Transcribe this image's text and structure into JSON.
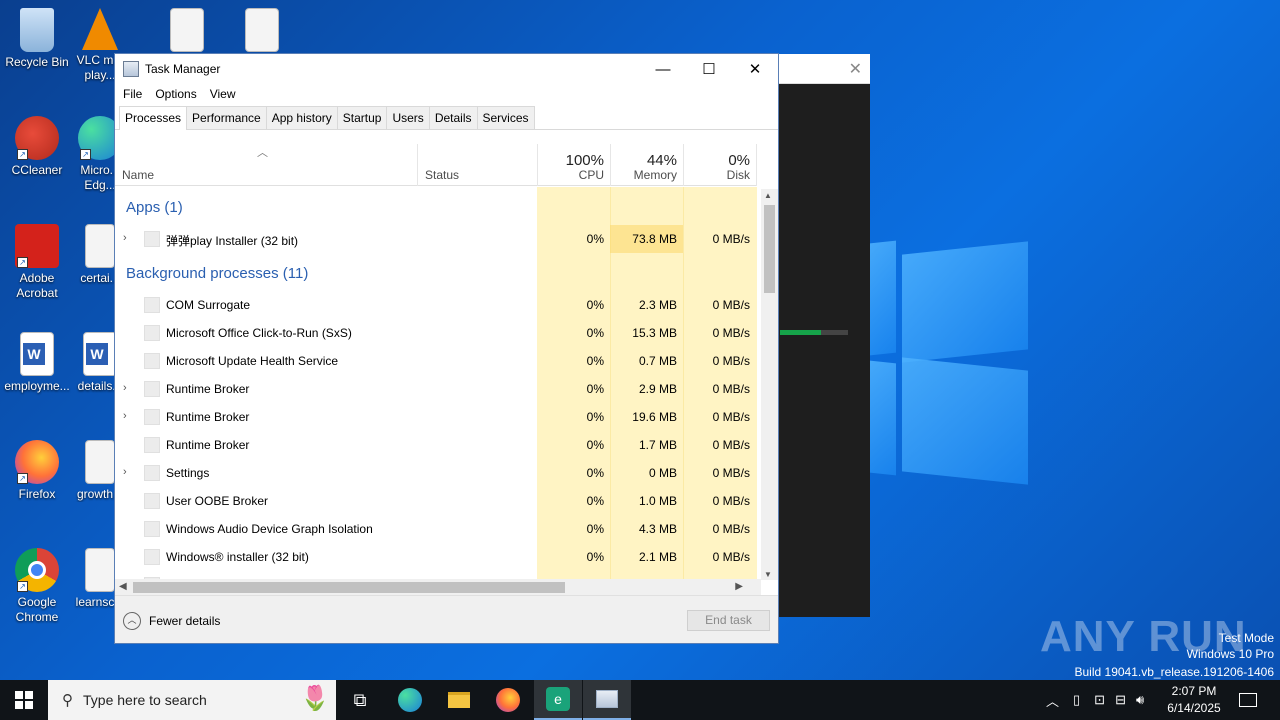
{
  "desktop": {
    "icons": [
      {
        "label": "Recycle Bin"
      },
      {
        "label": "VLC m... play..."
      },
      {
        "label": "CCleaner"
      },
      {
        "label": "Micro... Edg..."
      },
      {
        "label": "Adobe Acrobat"
      },
      {
        "label": "certai..."
      },
      {
        "label": "employme..."
      },
      {
        "label": "details..."
      },
      {
        "label": "Firefox"
      },
      {
        "label": "growth..."
      },
      {
        "label": "Google Chrome"
      },
      {
        "label": "learnsc..."
      }
    ]
  },
  "taskmanager": {
    "title": "Task Manager",
    "menu": [
      "File",
      "Options",
      "View"
    ],
    "tabs": [
      "Processes",
      "Performance",
      "App history",
      "Startup",
      "Users",
      "Details",
      "Services"
    ],
    "headers": {
      "name": "Name",
      "status": "Status",
      "cpu_pct": "100%",
      "cpu": "CPU",
      "mem_pct": "44%",
      "mem": "Memory",
      "disk_pct": "0%",
      "disk": "Disk"
    },
    "groups": {
      "apps": "Apps (1)",
      "background": "Background processes (11)"
    },
    "apps": [
      {
        "name": "弹弹play Installer (32 bit)",
        "cpu": "0%",
        "mem": "73.8 MB",
        "disk": "0 MB/s"
      }
    ],
    "background": [
      {
        "name": "COM Surrogate",
        "cpu": "0%",
        "mem": "2.3 MB",
        "disk": "0 MB/s"
      },
      {
        "name": "Microsoft Office Click-to-Run (SxS)",
        "cpu": "0%",
        "mem": "15.3 MB",
        "disk": "0 MB/s"
      },
      {
        "name": "Microsoft Update Health Service",
        "cpu": "0%",
        "mem": "0.7 MB",
        "disk": "0 MB/s"
      },
      {
        "name": "Runtime Broker",
        "cpu": "0%",
        "mem": "2.9 MB",
        "disk": "0 MB/s"
      },
      {
        "name": "Runtime Broker",
        "cpu": "0%",
        "mem": "19.6 MB",
        "disk": "0 MB/s"
      },
      {
        "name": "Runtime Broker",
        "cpu": "0%",
        "mem": "1.7 MB",
        "disk": "0 MB/s"
      },
      {
        "name": "Settings",
        "cpu": "0%",
        "mem": "0 MB",
        "disk": "0 MB/s"
      },
      {
        "name": "User OOBE Broker",
        "cpu": "0%",
        "mem": "1.0 MB",
        "disk": "0 MB/s"
      },
      {
        "name": "Windows Audio Device Graph Isolation",
        "cpu": "0%",
        "mem": "4.3 MB",
        "disk": "0 MB/s"
      },
      {
        "name": "Windows® installer (32 bit)",
        "cpu": "0%",
        "mem": "2.1 MB",
        "disk": "0 MB/s"
      }
    ],
    "fewer_details": "Fewer details",
    "end_task": "End task"
  },
  "watermark": {
    "brand": "ANY RUN",
    "line1": "Test Mode",
    "line2": "Windows 10 Pro",
    "line3": "Build 19041.vb_release.191206-1406"
  },
  "taskbar": {
    "search_placeholder": "Type here to search",
    "time": "2:07 PM",
    "date": "6/14/2025"
  }
}
